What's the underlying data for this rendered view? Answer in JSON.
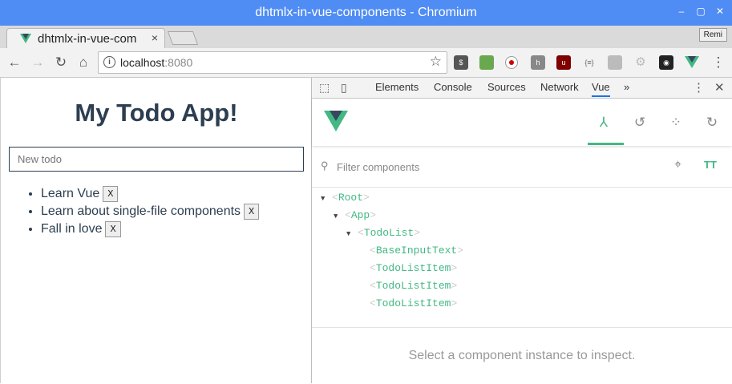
{
  "window": {
    "title": "dhtmlx-in-vue-components - Chromium"
  },
  "tab": {
    "title": "dhtmlx-in-vue-com",
    "close": "×"
  },
  "profile": {
    "name": "Remi"
  },
  "toolbar": {
    "url_host": "localhost",
    "url_port": ":8080"
  },
  "app": {
    "heading": "My Todo App!",
    "input_placeholder": "New todo",
    "remove_label": "X",
    "todos": [
      "Learn Vue",
      "Learn about single-file components",
      "Fall in love"
    ]
  },
  "devtools": {
    "tabs": [
      "Elements",
      "Console",
      "Sources",
      "Network",
      "Vue",
      "»"
    ],
    "active_tab": "Vue",
    "filter_placeholder": "Filter components",
    "tree": [
      {
        "name": "Root",
        "depth": 0,
        "expanded": true
      },
      {
        "name": "App",
        "depth": 1,
        "expanded": true
      },
      {
        "name": "TodoList",
        "depth": 2,
        "expanded": true
      },
      {
        "name": "BaseInputText",
        "depth": 3,
        "expanded": false
      },
      {
        "name": "TodoListItem",
        "depth": 3,
        "expanded": false
      },
      {
        "name": "TodoListItem",
        "depth": 3,
        "expanded": false
      },
      {
        "name": "TodoListItem",
        "depth": 3,
        "expanded": false
      }
    ],
    "inspect_message": "Select a component instance to inspect."
  },
  "colors": {
    "vue_green": "#42b883",
    "title_bar": "#4f8cf3",
    "heading": "#2c3e50"
  }
}
